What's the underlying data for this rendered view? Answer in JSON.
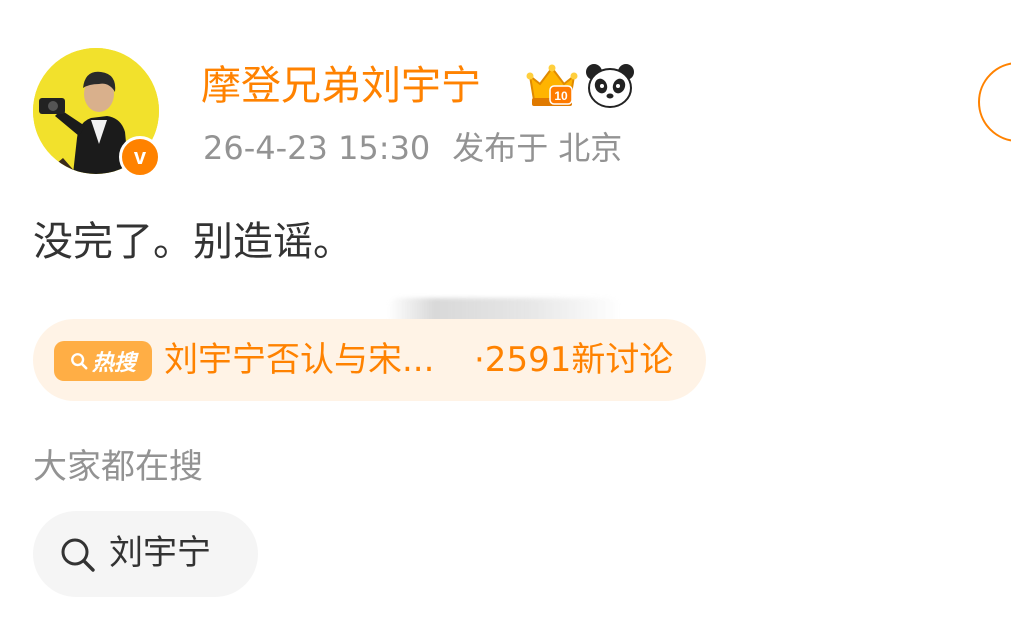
{
  "post": {
    "author": {
      "name": "摩登兄弟刘宇宁",
      "verified_badge": "v",
      "badges": [
        "vip-crown-icon",
        "panda-icon"
      ]
    },
    "meta": {
      "timestamp": "26-4-23 15:30",
      "location_prefix": "发布于",
      "location": "北京"
    },
    "text": "没完了。别造谣。"
  },
  "hot_search": {
    "badge_label": "热搜",
    "topic": "刘宇宁否认与宋...",
    "count": "·2591新讨论"
  },
  "related": {
    "title": "大家都在搜",
    "items": [
      {
        "label": "刘宇宁"
      }
    ]
  },
  "colors": {
    "accent": "#ff8200",
    "muted_text": "#939393",
    "body_text": "#333333",
    "pill_bg": "#fff3e6",
    "badge_bg": "#ffae45",
    "chip_bg": "#f5f5f5"
  }
}
